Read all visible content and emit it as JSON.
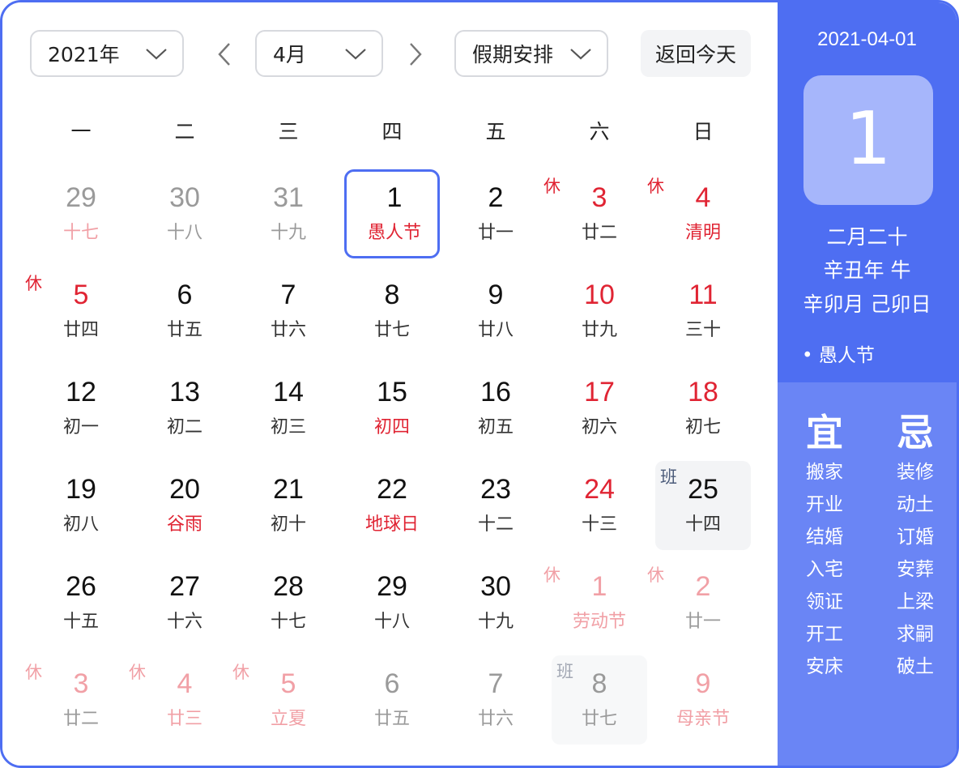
{
  "toolbar": {
    "year": "2021年",
    "month": "4月",
    "holiday": "假期安排",
    "today_button": "返回今天"
  },
  "weekdays": [
    "一",
    "二",
    "三",
    "四",
    "五",
    "六",
    "日"
  ],
  "grid": [
    [
      {
        "d": "29",
        "l": "十七",
        "other": true,
        "lred": true
      },
      {
        "d": "30",
        "l": "十八",
        "other": true
      },
      {
        "d": "31",
        "l": "十九",
        "other": true
      },
      {
        "d": "1",
        "l": "愚人节",
        "today": true,
        "lred": true
      },
      {
        "d": "2",
        "l": "廿一"
      },
      {
        "d": "3",
        "l": "廿二",
        "red": true,
        "tag": "休"
      },
      {
        "d": "4",
        "l": "清明",
        "red": true,
        "lred": true,
        "tag": "休"
      }
    ],
    [
      {
        "d": "5",
        "l": "廿四",
        "red": true,
        "tag": "休"
      },
      {
        "d": "6",
        "l": "廿五"
      },
      {
        "d": "7",
        "l": "廿六"
      },
      {
        "d": "8",
        "l": "廿七"
      },
      {
        "d": "9",
        "l": "廿八"
      },
      {
        "d": "10",
        "l": "廿九",
        "red": true
      },
      {
        "d": "11",
        "l": "三十",
        "red": true
      }
    ],
    [
      {
        "d": "12",
        "l": "初一"
      },
      {
        "d": "13",
        "l": "初二"
      },
      {
        "d": "14",
        "l": "初三"
      },
      {
        "d": "15",
        "l": "初四",
        "lred": true
      },
      {
        "d": "16",
        "l": "初五"
      },
      {
        "d": "17",
        "l": "初六",
        "red": true
      },
      {
        "d": "18",
        "l": "初七",
        "red": true
      }
    ],
    [
      {
        "d": "19",
        "l": "初八"
      },
      {
        "d": "20",
        "l": "谷雨",
        "lred": true
      },
      {
        "d": "21",
        "l": "初十"
      },
      {
        "d": "22",
        "l": "地球日",
        "lred": true
      },
      {
        "d": "23",
        "l": "十二"
      },
      {
        "d": "24",
        "l": "十三",
        "red": true
      },
      {
        "d": "25",
        "l": "十四",
        "work": true,
        "tag": "班"
      }
    ],
    [
      {
        "d": "26",
        "l": "十五"
      },
      {
        "d": "27",
        "l": "十六"
      },
      {
        "d": "28",
        "l": "十七"
      },
      {
        "d": "29",
        "l": "十八"
      },
      {
        "d": "30",
        "l": "十九"
      },
      {
        "d": "1",
        "l": "劳动节",
        "other": true,
        "red": true,
        "lred": true,
        "tag": "休"
      },
      {
        "d": "2",
        "l": "廿一",
        "other": true,
        "red": true,
        "tag": "休"
      }
    ],
    [
      {
        "d": "3",
        "l": "廿二",
        "other": true,
        "red": true,
        "tag": "休"
      },
      {
        "d": "4",
        "l": "廿三",
        "other": true,
        "red": true,
        "lred": true,
        "tag": "休"
      },
      {
        "d": "5",
        "l": "立夏",
        "other": true,
        "red": true,
        "lred": true,
        "tag": "休"
      },
      {
        "d": "6",
        "l": "廿五",
        "other": true
      },
      {
        "d": "7",
        "l": "廿六",
        "other": true
      },
      {
        "d": "8",
        "l": "廿七",
        "other": true,
        "work": true,
        "tag": "班"
      },
      {
        "d": "9",
        "l": "母亲节",
        "other": true,
        "red": true,
        "lred": true
      }
    ]
  ],
  "panel": {
    "date": "2021-04-01",
    "day": "1",
    "lunar": "二月二十",
    "ganzhi_year": "辛丑年 牛",
    "ganzhi_month_day": "辛卯月 己卯日",
    "festival": "• 愚人节",
    "yi_title": "宜",
    "ji_title": "忌",
    "yi": [
      "搬家",
      "开业",
      "结婚",
      "入宅",
      "领证",
      "开工",
      "安床"
    ],
    "ji": [
      "装修",
      "动土",
      "订婚",
      "安葬",
      "上梁",
      "求嗣",
      "破土"
    ]
  },
  "colors": {
    "accent": "#4e6ef2",
    "holiday_red": "#e02433",
    "faded_red": "#f1a0a6"
  }
}
